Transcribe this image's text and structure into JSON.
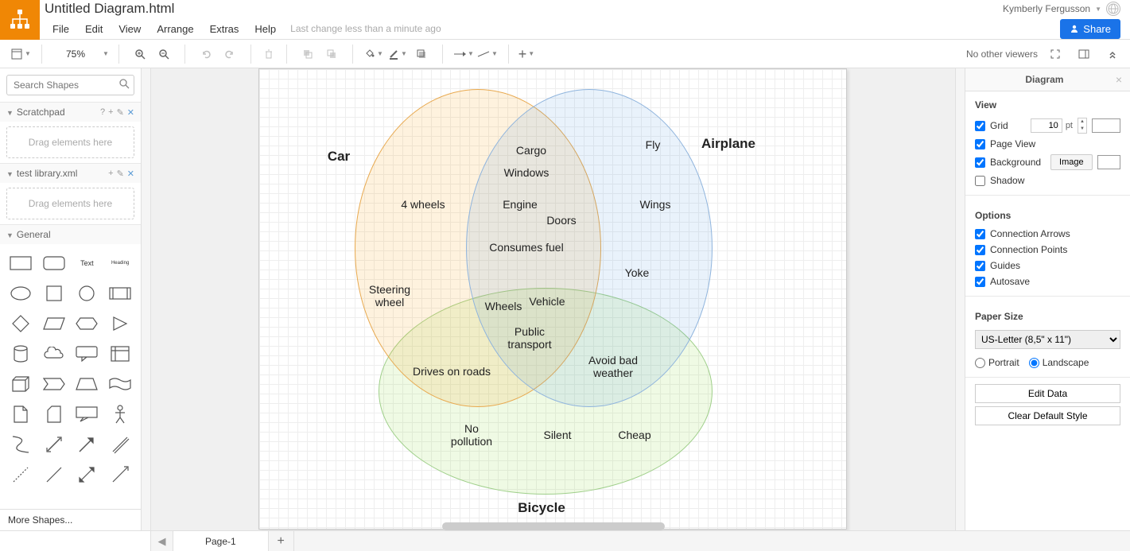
{
  "document": {
    "title": "Untitled Diagram.html"
  },
  "user": {
    "name": "Kymberly Fergusson"
  },
  "menu": {
    "items": [
      "File",
      "Edit",
      "View",
      "Arrange",
      "Extras",
      "Help"
    ],
    "last_change": "Last change less than a minute ago",
    "share": "Share"
  },
  "toolbar": {
    "zoom": "75%",
    "viewers": "No other viewers"
  },
  "left": {
    "search_placeholder": "Search Shapes",
    "scratchpad": "Scratchpad",
    "drop_hint": "Drag elements here",
    "test_lib": "test library.xml",
    "general": "General",
    "text_label": "Text",
    "heading_label": "Heading",
    "more": "More Shapes..."
  },
  "chart_data": {
    "type": "venn",
    "sets": [
      {
        "name": "Car",
        "items": [
          "4 wheels",
          "Steering wheel"
        ]
      },
      {
        "name": "Airplane",
        "items": [
          "Fly",
          "Wings",
          "Yoke"
        ]
      },
      {
        "name": "Bicycle",
        "items": [
          "No pollution",
          "Silent",
          "Cheap"
        ]
      }
    ],
    "intersections": {
      "Car_Airplane": [
        "Cargo",
        "Windows",
        "Engine",
        "Doors",
        "Consumes fuel"
      ],
      "Car_Bicycle": [
        "Drives on roads"
      ],
      "Airplane_Bicycle": [
        "Avoid bad weather"
      ],
      "Car_Airplane_Bicycle": [
        "Wheels",
        "Vehicle",
        "Public transport"
      ]
    }
  },
  "right": {
    "title": "Diagram",
    "view_heading": "View",
    "grid": "Grid",
    "grid_size": "10",
    "grid_unit": "pt",
    "page_view": "Page View",
    "background": "Background",
    "image_btn": "Image",
    "shadow": "Shadow",
    "options_heading": "Options",
    "conn_arrows": "Connection Arrows",
    "conn_points": "Connection Points",
    "guides": "Guides",
    "autosave": "Autosave",
    "paper_heading": "Paper Size",
    "paper_value": "US-Letter (8,5\" x 11\")",
    "portrait": "Portrait",
    "landscape": "Landscape",
    "edit_data": "Edit Data",
    "clear_style": "Clear Default Style"
  },
  "tabs": {
    "page1": "Page-1"
  }
}
